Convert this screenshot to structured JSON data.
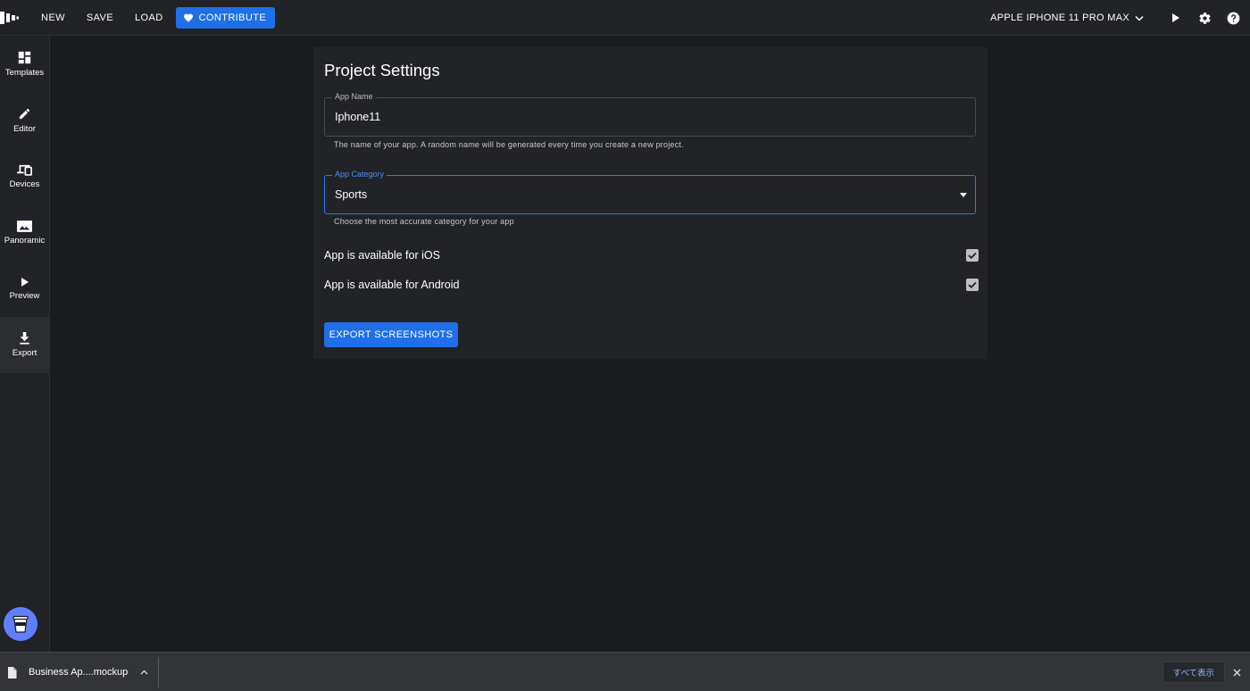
{
  "topbar": {
    "new_label": "NEW",
    "save_label": "SAVE",
    "load_label": "LOAD",
    "contribute_label": "CONTRIBUTE",
    "device_label": "APPLE IPHONE 11 PRO MAX",
    "icons": [
      "logo-icon",
      "heart-icon",
      "chevron-down-icon",
      "play-icon",
      "gear-icon",
      "help-icon"
    ]
  },
  "sidebar": {
    "items": [
      {
        "label": "Templates",
        "icon": "dashboard-icon"
      },
      {
        "label": "Editor",
        "icon": "pencil-icon"
      },
      {
        "label": "Devices",
        "icon": "devices-icon"
      },
      {
        "label": "Panoramic",
        "icon": "image-icon"
      },
      {
        "label": "Preview",
        "icon": "play-icon"
      },
      {
        "label": "Export",
        "icon": "download-icon"
      }
    ],
    "active": "Export"
  },
  "settings": {
    "title": "Project Settings",
    "app_name": {
      "label": "App Name",
      "value": "Iphone11",
      "helper": "The name of your app. A random name will be generated every time you create a new project."
    },
    "app_category": {
      "label": "App Category",
      "value": "Sports",
      "helper": "Choose the most accurate category for your app"
    },
    "ios": {
      "label": "App is available for iOS",
      "checked": true
    },
    "android": {
      "label": "App is available for Android",
      "checked": true
    },
    "export_label": "EXPORT SCREENSHOTS"
  },
  "downloads": {
    "file_name": "Business Ap....mockup",
    "show_all": "すべて表示"
  },
  "colors": {
    "accent": "#1f6fe8",
    "background": "#1a1b1e",
    "panel": "#222326",
    "focus": "#2b78f0"
  }
}
